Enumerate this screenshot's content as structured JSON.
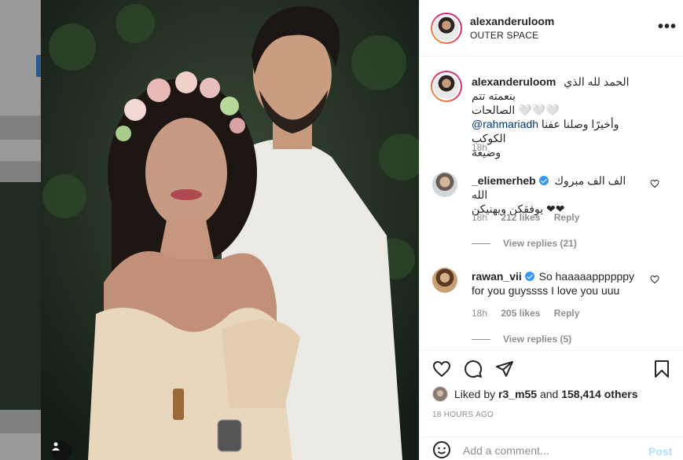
{
  "post": {
    "username": "alexanderuloom",
    "location": "OUTER SPACE",
    "caption": {
      "username": "alexanderuloom",
      "line1": "الحمد لله الذي بنعمته تتم",
      "line2": "الصالحات 🤍🤍🤍",
      "mention": "@rahmariadh",
      "line3": "وأخيرًا وصلنا عفنا الكوكب",
      "line4": "وضيعة",
      "time": "18h"
    },
    "comments": [
      {
        "username": "_eliemerheb",
        "verified": true,
        "text_line1": "الف الف مبروك الله",
        "text_line2": "يوفقكن ويهنيكن ❤❤",
        "time": "18h",
        "likes": "212 likes",
        "reply": "Reply",
        "view_replies": "View replies (21)"
      },
      {
        "username": "rawan_vii",
        "verified": true,
        "text_line1": "So haaaaappppppy",
        "text_line2": "for you guyssss I love you uuu",
        "time": "18h",
        "likes": "205 likes",
        "reply": "Reply",
        "view_replies": "View replies (5)"
      }
    ],
    "liked_by": {
      "prefix": "Liked by",
      "user": "r3_m55",
      "and": "and",
      "others": "158,414 others"
    },
    "ago": "18 HOURS AGO",
    "comment_input": {
      "placeholder": "Add a comment...",
      "post_label": "Post"
    },
    "icons": [
      "heart-icon",
      "comment-icon",
      "share-icon",
      "bookmark-icon",
      "emoji-icon",
      "more-options-icon",
      "user-tag-icon"
    ]
  }
}
